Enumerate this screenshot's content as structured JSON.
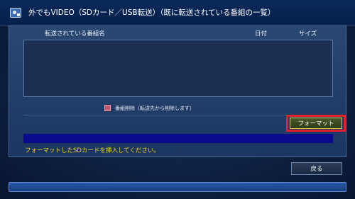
{
  "window": {
    "title": "外でもVIDEO（SDカード／USB転送）（既に転送されている番組の一覧）"
  },
  "table": {
    "columns": [
      "転送されている番組名",
      "日付",
      "サイズ"
    ],
    "rows": []
  },
  "delete_option": {
    "label": "番組削除（転送先から削除します）"
  },
  "buttons": {
    "format_label": "フォーマット",
    "back_label": "戻る"
  },
  "status": {
    "message": "フォーマットしたSDカードを挿入してください。"
  },
  "icons": {
    "app": "app-icon",
    "checkbox": "checkbox-icon"
  },
  "colors": {
    "highlight_border": "#e3202a",
    "message_text": "#f2d21e",
    "progress_fill": "#0a0a8c"
  }
}
